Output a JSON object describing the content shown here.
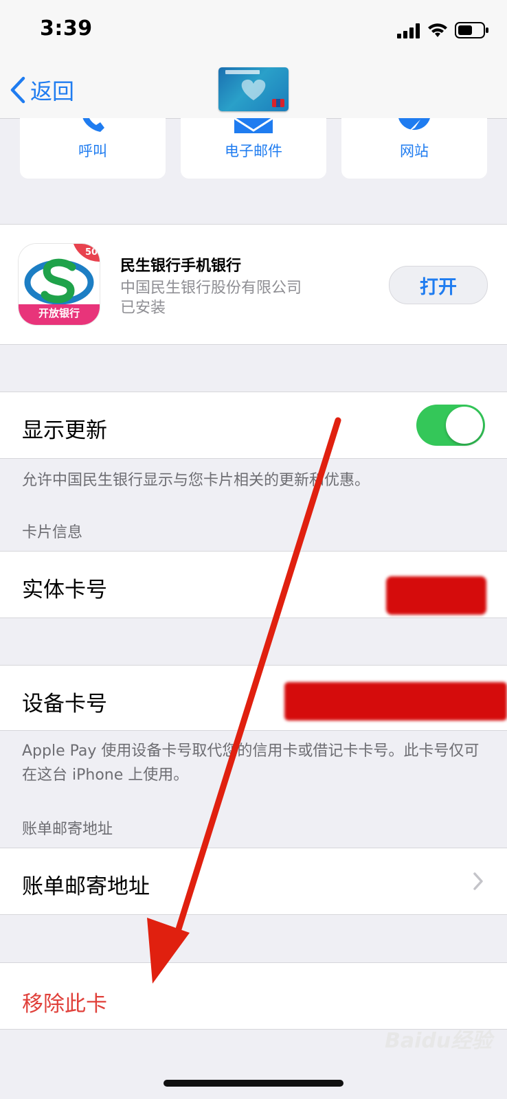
{
  "status_bar": {
    "time": "3:39"
  },
  "nav": {
    "back_label": "返回"
  },
  "actions": [
    {
      "label": "呼叫",
      "icon": "phone-icon"
    },
    {
      "label": "电子邮件",
      "icon": "mail-icon"
    },
    {
      "label": "网站",
      "icon": "compass-icon"
    }
  ],
  "app": {
    "name": "民生银行手机银行",
    "company": "中国民生银行股份有限公司",
    "status": "已安装",
    "icon_badge": "50",
    "icon_banner": "开放银行",
    "open_label": "打开"
  },
  "show_updates": {
    "label": "显示更新",
    "enabled": true,
    "footer": "允许中国民生银行显示与您卡片相关的更新和优惠。"
  },
  "card_info": {
    "header": "卡片信息",
    "physical_label": "实体卡号",
    "device_label": "设备卡号",
    "device_footer": "Apple Pay 使用设备卡号取代您的信用卡或借记卡卡号。此卡号仅可在这台 iPhone 上使用。"
  },
  "billing": {
    "header": "账单邮寄地址",
    "row_label": "账单邮寄地址"
  },
  "remove": {
    "label": "移除此卡"
  },
  "watermark": "Baidu经验",
  "colors": {
    "accent_blue": "#1f7cf0",
    "toggle_green": "#34c759",
    "destructive_red": "#e0403a",
    "annotation_arrow": "#e0200f"
  }
}
